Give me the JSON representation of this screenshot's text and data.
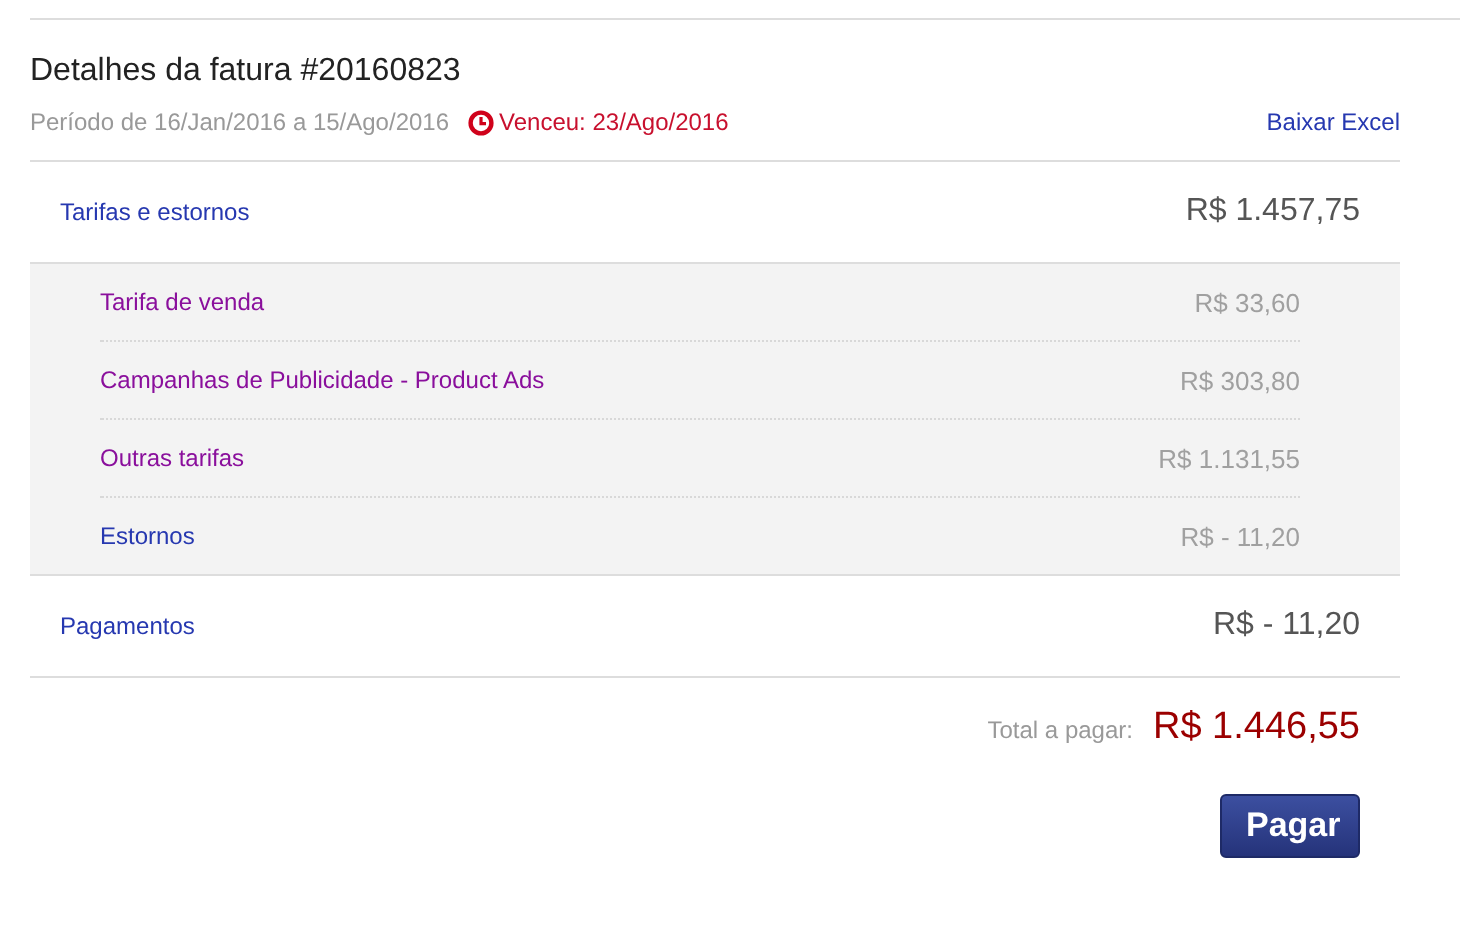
{
  "title": "Detalhes da fatura #20160823",
  "period": "Período de 16/Jan/2016 a 15/Ago/2016",
  "due": "Venceu: 23/Ago/2016",
  "export_link": "Baixar Excel",
  "charges": {
    "label": "Tarifas e estornos",
    "amount": "R$ 1.457,75",
    "items": [
      {
        "label": "Tarifa de venda",
        "amount": "R$ 33,60",
        "visited": true
      },
      {
        "label": "Campanhas de Publicidade - Product Ads",
        "amount": "R$ 303,80",
        "visited": true
      },
      {
        "label": "Outras tarifas",
        "amount": "R$ 1.131,55",
        "visited": true
      },
      {
        "label": "Estornos",
        "amount": "R$ - 11,20",
        "visited": false
      }
    ]
  },
  "payments": {
    "label": "Pagamentos",
    "amount": "R$ - 11,20"
  },
  "total": {
    "label": "Total a pagar:",
    "amount": "R$ 1.446,55"
  },
  "pay_button": "Pagar"
}
